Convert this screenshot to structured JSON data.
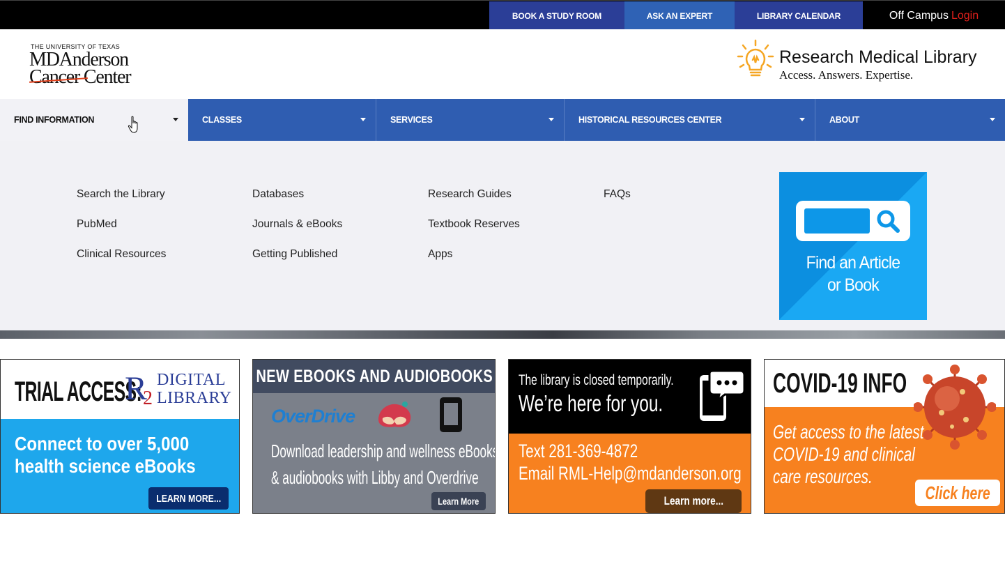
{
  "topbar": {
    "book_study_room": "BOOK A STUDY ROOM",
    "ask_expert": "ASK AN EXPERT",
    "library_calendar": "LIBRARY CALENDAR",
    "off_campus": "Off Campus",
    "login": "Login"
  },
  "header": {
    "logo": {
      "university": "THE UNIVERSITY OF TEXAS",
      "line1": "MDAnderson",
      "line2": "Cancer Center"
    },
    "library_title": "Research Medical Library",
    "library_tagline": "Access. Answers. Expertise."
  },
  "nav": {
    "items": [
      {
        "label": "FIND INFORMATION"
      },
      {
        "label": "CLASSES"
      },
      {
        "label": "SERVICES"
      },
      {
        "label": "HISTORICAL RESOURCES CENTER"
      },
      {
        "label": "ABOUT"
      }
    ]
  },
  "mega_menu": {
    "columns": [
      [
        "Search the Library",
        "PubMed",
        "Clinical Resources"
      ],
      [
        "Databases",
        "Journals & eBooks",
        "Getting Published"
      ],
      [
        "Research Guides",
        "Textbook Reserves",
        "Apps"
      ],
      [
        "FAQs"
      ]
    ],
    "card": {
      "line1": "Find an Article",
      "line2": "or Book"
    }
  },
  "promos": {
    "trial": {
      "heading": "TRIAL ACCESS:",
      "logo_r": "R",
      "logo_two": "2",
      "logo_line1": "DIGITAL",
      "logo_line2": "LIBRARY",
      "line1": "Connect to over 5,000",
      "line2": "health science eBooks",
      "button": "LEARN MORE..."
    },
    "ebooks": {
      "heading": "NEW EBOOKS AND AUDIOBOOKS",
      "overdrive": "OverDrive",
      "line1": "Download leadership and wellness eBooks",
      "line2": "& audiobooks with Libby and Overdrive",
      "button": "Learn More"
    },
    "closed": {
      "line1": "The library is closed temporarily.",
      "line2": "We’re here for you.",
      "text": "Text 281-369-4872",
      "email": "Email RML-Help@mdanderson.org",
      "button": "Learn more..."
    },
    "covid": {
      "heading": "COVID-19 INFO",
      "line1": "Get access to the latest",
      "line2": "COVID-19 and clinical",
      "line3": "care resources.",
      "button": "Click here"
    }
  },
  "colors": {
    "nav_blue": "#2f5db1",
    "top_dark_blue": "#2b3e97",
    "login_red": "#e0201b",
    "orange": "#f7811f",
    "sky_blue": "#1ea7ec"
  }
}
